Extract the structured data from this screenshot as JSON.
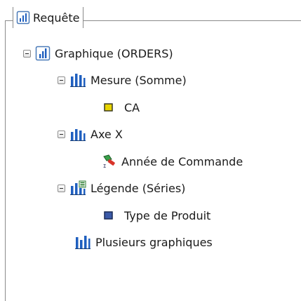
{
  "group": {
    "title": "Requête"
  },
  "tree": {
    "root": {
      "label": "Graphique (ORDERS)",
      "icon": "chart-icon",
      "expanded": true
    },
    "measure": {
      "label": "Mesure (Somme)",
      "icon": "bar-chart-icon",
      "expanded": true
    },
    "measure_item": {
      "label": "CA",
      "icon": "measure-square-icon"
    },
    "xaxis": {
      "label": "Axe X",
      "icon": "bar-chart-icon",
      "expanded": true
    },
    "xaxis_item": {
      "label": "Année de Commande",
      "icon": "dimension-icon"
    },
    "legend": {
      "label": "Légende (Séries)",
      "icon": "legend-chart-icon",
      "expanded": true
    },
    "legend_item": {
      "label": "Type de Produit",
      "icon": "dimension-square-icon"
    },
    "multi": {
      "label": "Plusieurs graphiques",
      "icon": "bar-chart-icon"
    }
  },
  "colors": {
    "bar_blue": "#1f5fbf",
    "measure_yellow": "#e8d400",
    "border": "#8a8a8a"
  }
}
